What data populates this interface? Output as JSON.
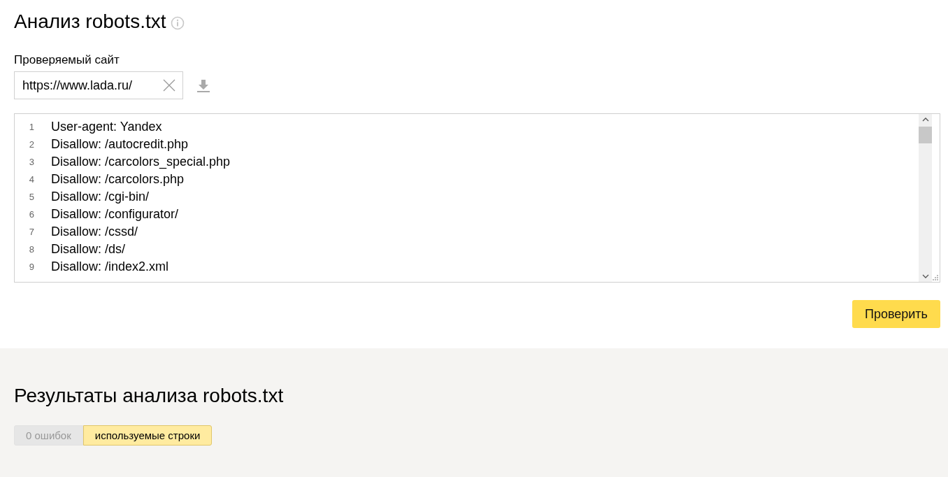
{
  "title": "Анализ robots.txt",
  "site_field": {
    "label": "Проверяемый сайт",
    "value": "https://www.lada.ru/"
  },
  "editor": {
    "lines": [
      {
        "number": "1",
        "text": "User-agent: Yandex"
      },
      {
        "number": "2",
        "text": "Disallow: /autocredit.php"
      },
      {
        "number": "3",
        "text": "Disallow: /carcolors_special.php"
      },
      {
        "number": "4",
        "text": "Disallow: /carcolors.php"
      },
      {
        "number": "5",
        "text": "Disallow: /cgi-bin/"
      },
      {
        "number": "6",
        "text": "Disallow: /configurator/"
      },
      {
        "number": "7",
        "text": "Disallow: /cssd/"
      },
      {
        "number": "8",
        "text": "Disallow: /ds/"
      },
      {
        "number": "9",
        "text": "Disallow: /index2.xml"
      }
    ]
  },
  "check_button": "Проверить",
  "results": {
    "title": "Результаты анализа robots.txt",
    "tabs": [
      {
        "label": "0 ошибок",
        "selected": false,
        "disabled": true
      },
      {
        "label": "используемые строки",
        "selected": true,
        "disabled": false
      }
    ]
  }
}
